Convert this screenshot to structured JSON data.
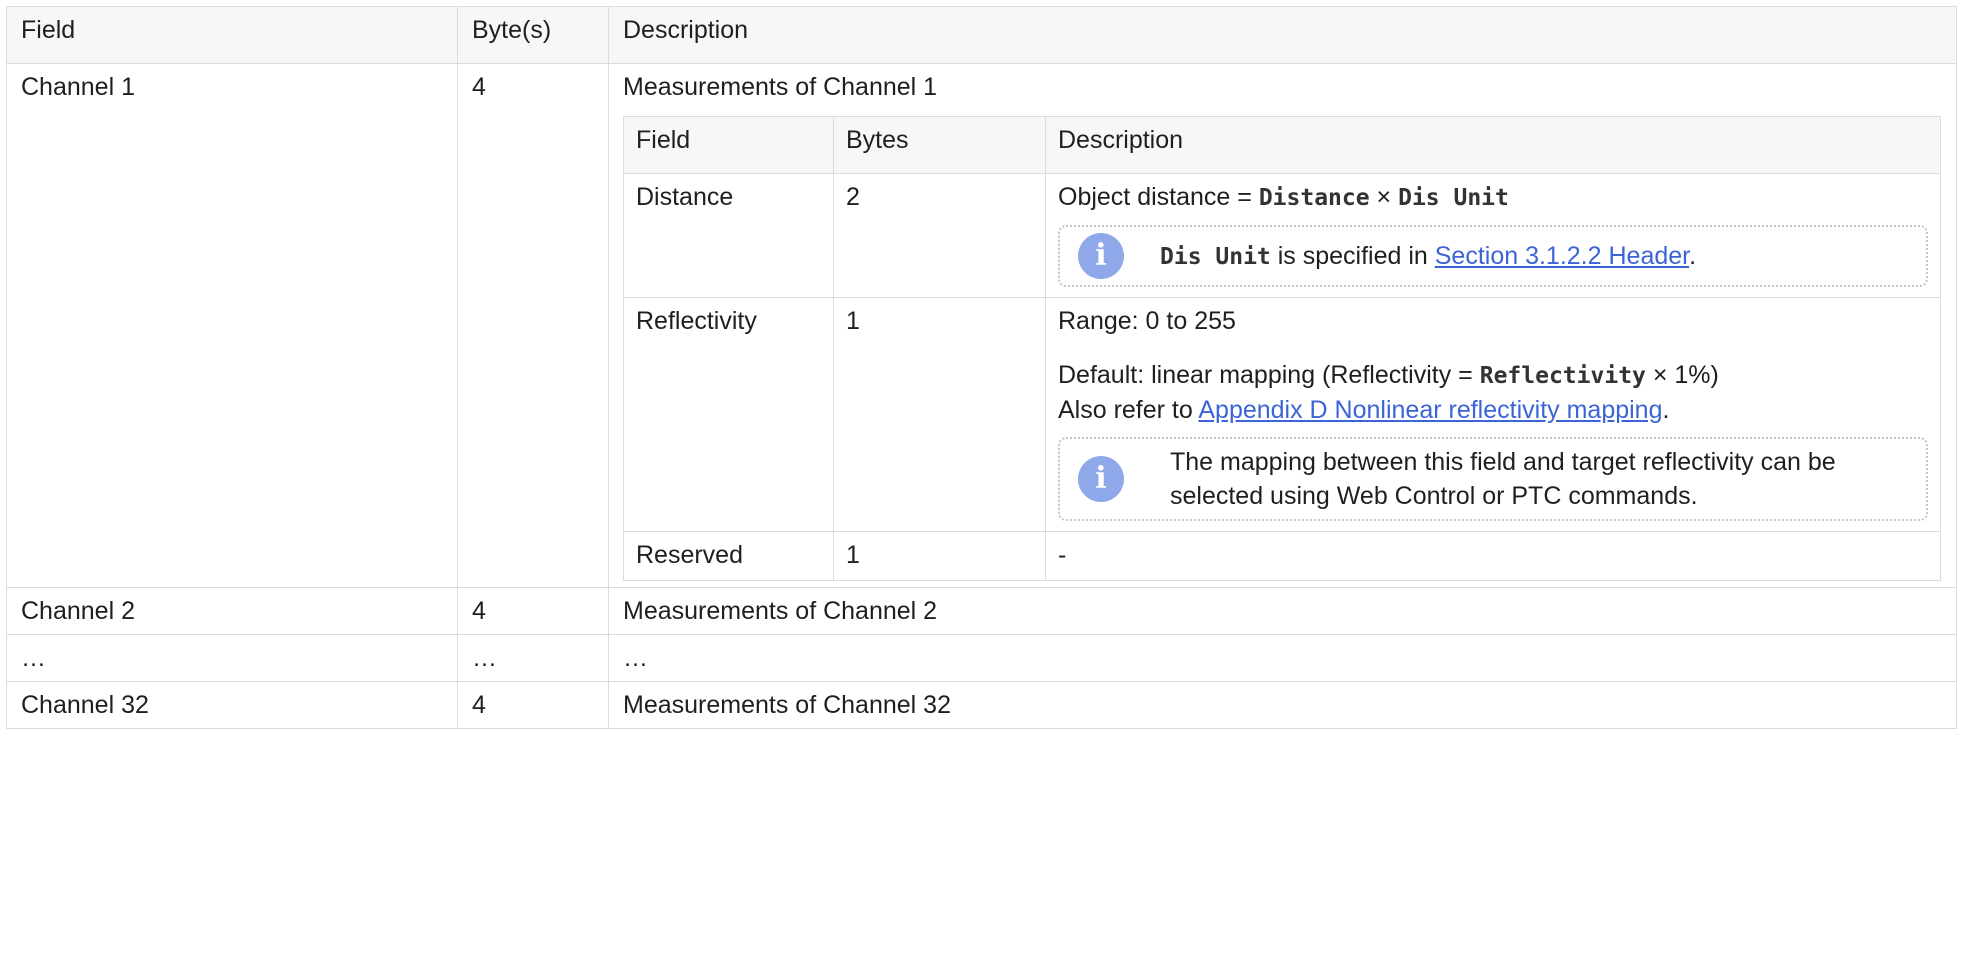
{
  "outer": {
    "headers": [
      "Field",
      "Byte(s)",
      "Description"
    ],
    "rows": [
      {
        "field": "Channel 1",
        "bytes": "4",
        "description": "Measurements of Channel 1"
      },
      {
        "field": "Channel 2",
        "bytes": "4",
        "description": "Measurements of Channel 2"
      },
      {
        "field": "…",
        "bytes": "…",
        "description": "…"
      },
      {
        "field": "Channel 32",
        "bytes": "4",
        "description": "Measurements of Channel 32"
      }
    ]
  },
  "inner": {
    "headers": [
      "Field",
      "Bytes",
      "Description"
    ],
    "distance": {
      "field": "Distance",
      "bytes": "2",
      "desc_prefix": "Object distance = ",
      "code1": "Distance",
      "times": " × ",
      "code2": "Dis Unit",
      "note_code": "Dis Unit",
      "note_text": " is specified in ",
      "note_link": "Section 3.1.2.2 Header",
      "note_end": "."
    },
    "reflectivity": {
      "field": "Reflectivity",
      "bytes": "1",
      "range": "Range: 0 to 255",
      "default_prefix": "Default: linear mapping (Reflectivity = ",
      "code": "Reflectivity",
      "default_suffix": " × 1%)",
      "also_text": "Also refer to ",
      "also_link": "Appendix D Nonlinear reflectivity mapping",
      "also_end": ".",
      "note_text": "The mapping between this field and target reflectivity can be selected using Web Control or PTC commands."
    },
    "reserved": {
      "field": "Reserved",
      "bytes": "1",
      "description": "-"
    }
  },
  "icons": {
    "info": "info-icon"
  },
  "colors": {
    "link": "#3b64d6",
    "info_icon": "#8fa8ea",
    "header_bg": "#f7f7f7",
    "border": "#dcdcdc"
  }
}
